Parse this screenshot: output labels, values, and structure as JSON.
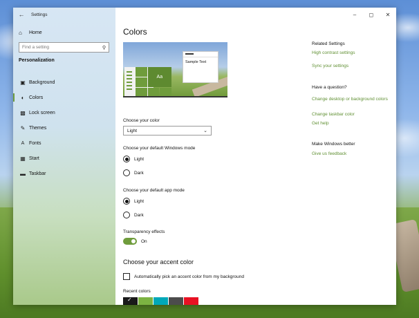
{
  "window": {
    "app_title": "Settings"
  },
  "sidebar": {
    "home_label": "Home",
    "search_placeholder": "Find a setting",
    "section_label": "Personalization",
    "items": [
      {
        "label": "Background",
        "icon": "image-icon"
      },
      {
        "label": "Colors",
        "icon": "palette-icon"
      },
      {
        "label": "Lock screen",
        "icon": "lock-screen-icon"
      },
      {
        "label": "Themes",
        "icon": "brush-icon"
      },
      {
        "label": "Fonts",
        "icon": "font-icon"
      },
      {
        "label": "Start",
        "icon": "start-icon"
      },
      {
        "label": "Taskbar",
        "icon": "taskbar-icon"
      }
    ],
    "active_item": "Colors"
  },
  "main": {
    "title": "Colors",
    "preview": {
      "sample_text": "Sample Text",
      "tile_text": "Aa"
    },
    "choose_color": {
      "label": "Choose your color",
      "selected": "Light"
    },
    "windows_mode": {
      "label": "Choose your default Windows mode",
      "options": [
        "Light",
        "Dark"
      ],
      "selected": "Light"
    },
    "app_mode": {
      "label": "Choose your default app mode",
      "options": [
        "Light",
        "Dark"
      ],
      "selected": "Light"
    },
    "transparency": {
      "label": "Transparency effects",
      "state": "On"
    },
    "accent": {
      "title": "Choose your accent color",
      "auto_checkbox_label": "Automatically pick an accent color from my background",
      "auto_checked": false,
      "recent_label": "Recent colors",
      "recent_colors": [
        "#1a1a1a",
        "#7cb342",
        "#00a8b8",
        "#4c4c4c",
        "#e81123"
      ]
    }
  },
  "right": {
    "related_title": "Related Settings",
    "related_links": [
      "High contrast settings",
      "Sync your settings"
    ],
    "question_title": "Have a question?",
    "question_links": [
      "Change desktop or background colors",
      "Change taskbar color",
      "Get help"
    ],
    "better_title": "Make Windows better",
    "better_links": [
      "Give us feedback"
    ]
  },
  "colors": {
    "accent": "#6f9c3c",
    "link": "#5f8f32"
  }
}
